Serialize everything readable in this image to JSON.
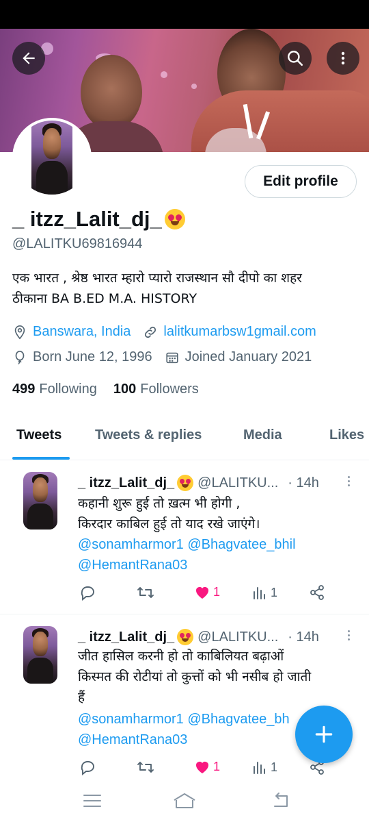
{
  "profile": {
    "name": "_ itzz_Lalit_dj_",
    "name_emoji": "heart-eyes-emoji",
    "handle": "@LALITKU69816944",
    "bio_line1": "एक भारत , श्रेष्ठ भारत  म्हारो प्यारो राजस्थान सौ दीपो का शहर",
    "bio_line2": "ठीकाना BA B.ED M.A. HISTORY",
    "location": "Banswara, India",
    "website": "lalitkumarbsw1gmail.com",
    "birthday": "Born June 12, 1996",
    "joined": "Joined January 2021",
    "following_count": "499",
    "following_label": "Following",
    "followers_count": "100",
    "followers_label": "Followers",
    "edit_label": "Edit profile"
  },
  "tabs": [
    {
      "label": "Tweets",
      "active": true
    },
    {
      "label": "Tweets & replies",
      "active": false
    },
    {
      "label": "Media",
      "active": false
    },
    {
      "label": "Likes",
      "active": false
    }
  ],
  "tweets": [
    {
      "name": "_ itzz_Lalit_dj_",
      "handle": "@LALITKU...",
      "time": "· 14h",
      "line1": "कहानी शुरू हुई तो ख़त्म भी होगी ,",
      "line2": "किरदार काबिल हुई तो याद रखे जाएंगे।",
      "mention1": "@sonamharmor1 @Bhagvatee_bhil",
      "mention2": "@HemantRana03",
      "likes": "1",
      "views": "1"
    },
    {
      "name": "_ itzz_Lalit_dj_",
      "handle": "@LALITKU...",
      "time": "· 14h",
      "line1": "जीत हासिल करनी हो तो काबिलियत बढ़ाओं",
      "line2": "किस्मत की रोटीयां तो कुत्तों को भी नसीब हो जाती",
      "line3": "हैं",
      "mention1": "@sonamharmor1 @Bhagvatee_bh",
      "mention2": "@HemantRana03",
      "likes": "1",
      "views": "1"
    }
  ],
  "colors": {
    "accent": "#1d9bf0",
    "like": "#f91880",
    "muted": "#536471"
  },
  "icons": [
    "back-arrow-icon",
    "search-icon",
    "more-vertical-icon",
    "location-pin-icon",
    "link-icon",
    "balloon-icon",
    "calendar-icon",
    "reply-icon",
    "retweet-icon",
    "heart-icon",
    "views-icon",
    "share-icon",
    "compose-plus-icon",
    "menu-icon",
    "home-icon",
    "back-icon"
  ]
}
